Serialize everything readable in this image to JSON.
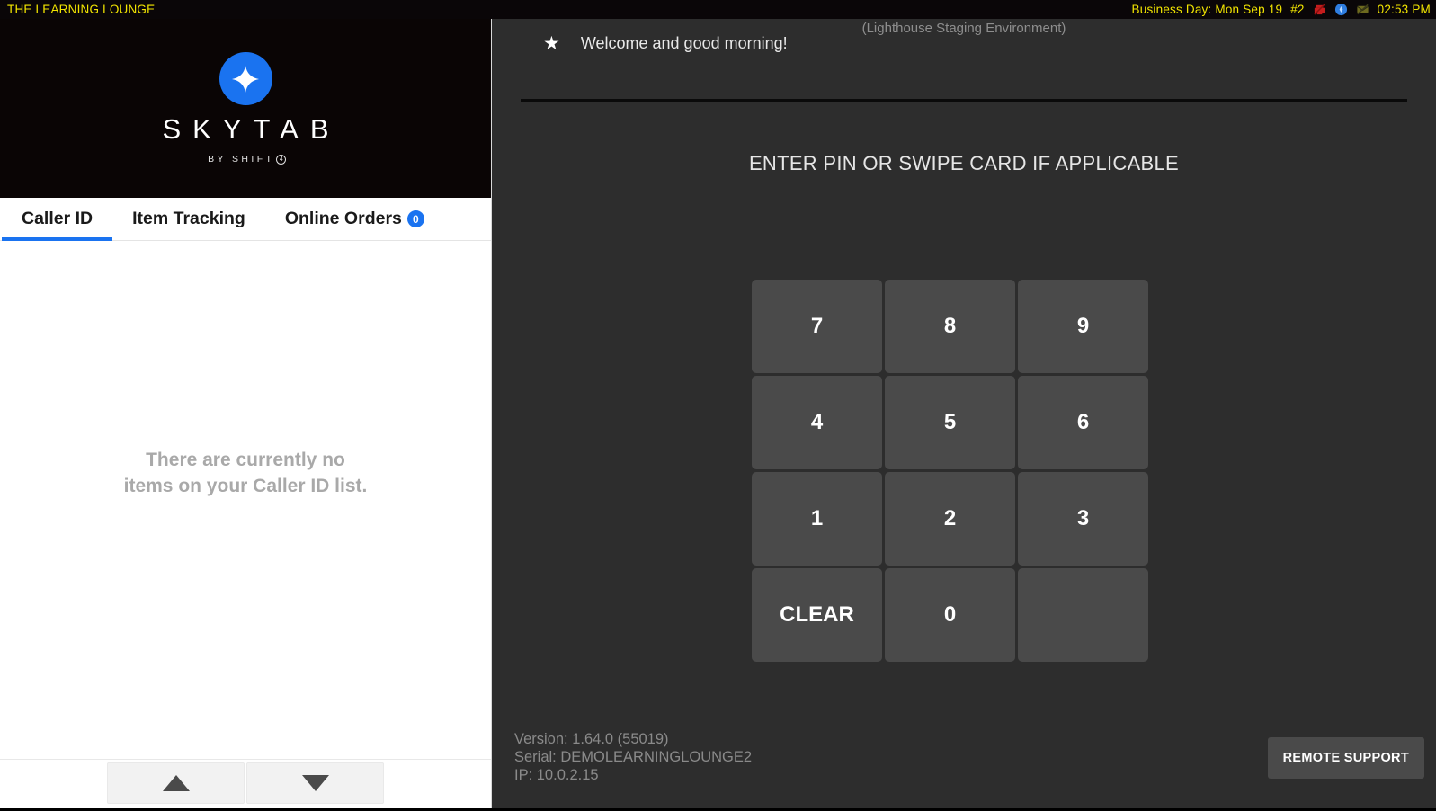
{
  "statusbar": {
    "store_name": "THE LEARNING LOUNGE",
    "business_day": "Business Day: Mon Sep 19",
    "terminal": "#2",
    "time": "02:53 PM",
    "icons": [
      {
        "name": "no-printer-icon",
        "color": "#c41d1d"
      },
      {
        "name": "sync-status-icon",
        "color": "#2f7de0"
      },
      {
        "name": "no-network-icon",
        "color": "#6e6a1f"
      }
    ],
    "text_color": "#f2e500",
    "background": "#0a0608"
  },
  "left_panel": {
    "logo": {
      "wordmark": "SKYTAB",
      "tagline": "BY SHIFT",
      "tagline_mark": "4",
      "accent_color": "#1a73f0"
    },
    "tabs": [
      {
        "label": "Caller ID",
        "active": true,
        "badge": null
      },
      {
        "label": "Item Tracking",
        "active": false,
        "badge": null
      },
      {
        "label": "Online Orders",
        "active": false,
        "badge": "0"
      }
    ],
    "empty_state": {
      "line1": "There are currently no",
      "line2": "items on your Caller ID list."
    },
    "scroll": {
      "up_label": "scroll-up",
      "down_label": "scroll-down"
    }
  },
  "right_panel": {
    "environment_label": "(Lighthouse Staging Environment)",
    "welcome_message": "Welcome and good morning!",
    "pin_prompt": "ENTER PIN OR SWIPE CARD IF APPLICABLE",
    "keypad": [
      {
        "label": "7",
        "kind": "digit"
      },
      {
        "label": "8",
        "kind": "digit"
      },
      {
        "label": "9",
        "kind": "digit"
      },
      {
        "label": "4",
        "kind": "digit"
      },
      {
        "label": "5",
        "kind": "digit"
      },
      {
        "label": "6",
        "kind": "digit"
      },
      {
        "label": "1",
        "kind": "digit"
      },
      {
        "label": "2",
        "kind": "digit"
      },
      {
        "label": "3",
        "kind": "digit"
      },
      {
        "label": "CLEAR",
        "kind": "action"
      },
      {
        "label": "0",
        "kind": "digit"
      },
      {
        "label": "",
        "kind": "empty"
      }
    ],
    "system_info": {
      "version": "Version: 1.64.0 (55019)",
      "serial": "Serial: DEMOLEARNINGLOUNGE2",
      "ip": "IP: 10.0.2.15"
    },
    "remote_support_label": "REMOTE SUPPORT"
  }
}
